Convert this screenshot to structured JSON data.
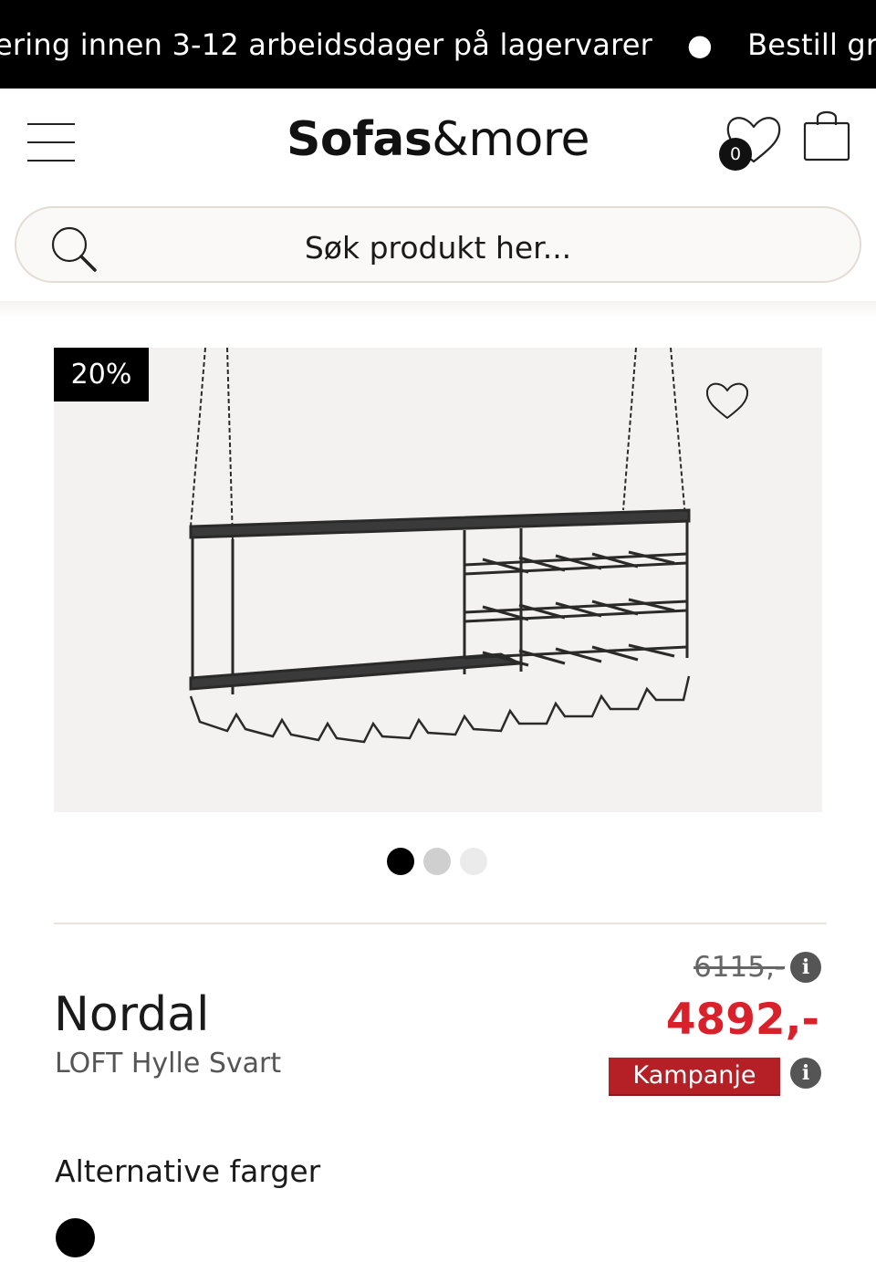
{
  "announcement": {
    "text_1": "ering innen 3-12 arbeidsdager på lagervarer",
    "separator": "●",
    "text_2": "Bestill grat"
  },
  "header": {
    "logo_bold": "Sofas",
    "logo_light": "&more",
    "wishlist_count": "0",
    "icons": [
      "menu-icon",
      "heart-icon",
      "shopping-bag-icon"
    ]
  },
  "search": {
    "placeholder": "Søk produkt her..."
  },
  "product": {
    "discount_badge": "20%",
    "brand": "Nordal",
    "name": "LOFT Hylle Svart",
    "old_price": "6115,-",
    "sale_price": "4892,-",
    "campaign_label": "Kampanje",
    "info_glyph": "i",
    "image_count": 3,
    "active_image": 1
  },
  "alternatives": {
    "title": "Alternative farger",
    "colors": [
      "#000000"
    ]
  },
  "colors": {
    "accent_red": "#d8212a",
    "campaign_bg": "#b51f26",
    "bar_bg": "#000000"
  }
}
